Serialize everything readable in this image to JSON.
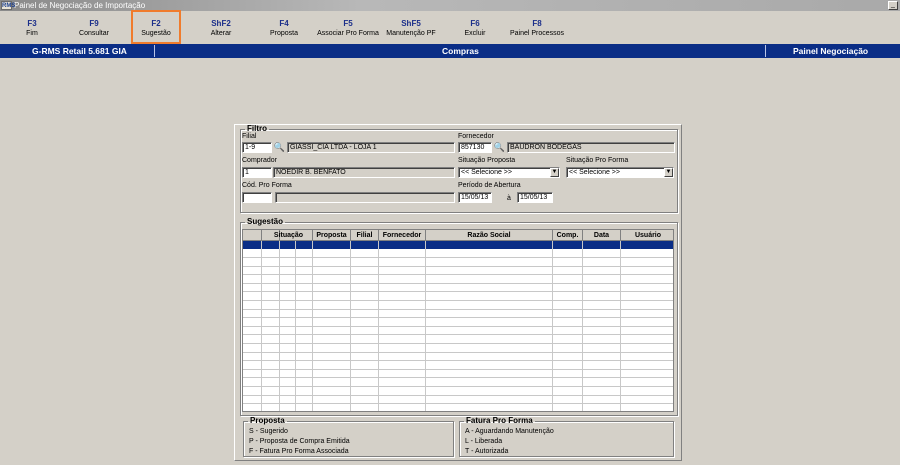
{
  "window": {
    "title": "Painel de Negociação de Importação",
    "icon_text": "RMS"
  },
  "fkeys": [
    {
      "key": "F3",
      "label": "Fim"
    },
    {
      "key": "F9",
      "label": "Consultar"
    },
    {
      "key": "F2",
      "label": "Sugestão",
      "active": true
    },
    {
      "key": "ShF2",
      "label": "Alterar"
    },
    {
      "key": "F4",
      "label": "Proposta"
    },
    {
      "key": "F5",
      "label": "Associar Pro Forma"
    },
    {
      "key": "ShF5",
      "label": "Manutenção PF"
    },
    {
      "key": "F6",
      "label": "Excluir"
    },
    {
      "key": "F8",
      "label": "Painel Processos"
    }
  ],
  "header": {
    "system": "G-RMS Retail 5.681 GIA",
    "module": "Compras",
    "screen": "Painel Negociação"
  },
  "filtro": {
    "legend": "Filtro",
    "filial_label": "Filial",
    "filial_code": "1-9",
    "filial_name": "GIASSI_CIA LTDA - LOJA 1",
    "fornecedor_label": "Fornecedor",
    "fornecedor_code": "857130",
    "fornecedor_name": "BAUDRON BODEGAS",
    "comprador_label": "Comprador",
    "comprador_code": "1",
    "comprador_name": "NOEDIR B. BENFATO",
    "situacao_proposta_label": "Situação Proposta",
    "situacao_proposta_value": "<< Selecione >>",
    "situacao_proforma_label": "Situação Pro Forma",
    "situacao_proforma_value": "<< Selecione >>",
    "cod_proforma_label": "Cód. Pro Forma",
    "cod_proforma_value": "",
    "cod_proforma_desc": "",
    "periodo_label": "Período de Abertura",
    "periodo_de": "15/05/13",
    "periodo_sep": "à",
    "periodo_ate": "15/05/13"
  },
  "sugestao": {
    "legend": "Sugestão",
    "columns": [
      "",
      "Situação",
      "",
      "",
      "Proposta",
      "Filial",
      "Fornecedor",
      "Razão Social",
      "Comp.",
      "Data",
      "Usuário"
    ]
  },
  "legend_proposta": {
    "title": "Proposta",
    "items": [
      "S - Sugerido",
      "P - Proposta de Compra Emitida",
      "F - Fatura Pro Forma Associada"
    ]
  },
  "legend_fatura": {
    "title": "Fatura Pro Forma",
    "items": [
      "A - Aguardando Manutenção",
      "L - Liberada",
      "T - Autorizada"
    ]
  },
  "colors": {
    "header_blue": "#0a2d86",
    "fkey_blue": "#1b2e8a",
    "highlight": "#f07b2c",
    "background": "#d4d0c8"
  }
}
